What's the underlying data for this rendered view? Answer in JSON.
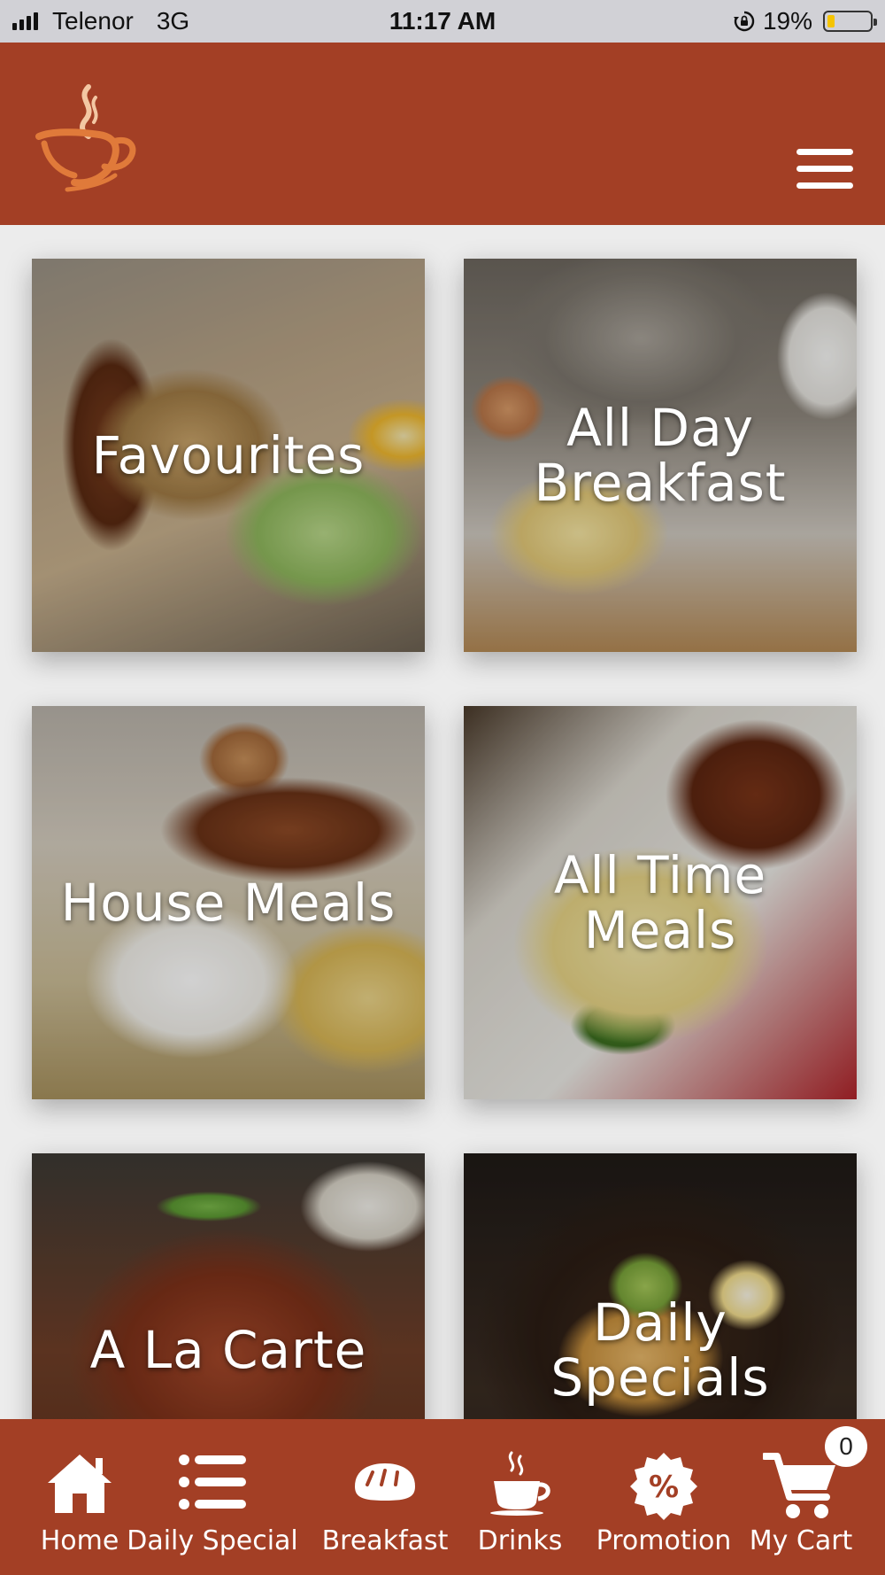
{
  "status_bar": {
    "carrier": "Telenor",
    "network": "3G",
    "time": "11:17 AM",
    "battery": "19%",
    "battery_level": 0.19
  },
  "header": {
    "logo_icon": "coffee-cup-logo-icon",
    "menu_icon": "hamburger-menu-icon"
  },
  "categories": [
    {
      "label": "Favourites"
    },
    {
      "label": "All Day Breakfast"
    },
    {
      "label": "House Meals"
    },
    {
      "label": "All Time Meals"
    },
    {
      "label": "A La Carte"
    },
    {
      "label": "Daily Specials"
    }
  ],
  "bottom_nav": {
    "items": [
      {
        "label": "Home",
        "icon": "home-icon"
      },
      {
        "label": "Daily Special",
        "icon": "list-icon"
      },
      {
        "label": "Breakfast",
        "icon": "bread-icon"
      },
      {
        "label": "Drinks",
        "icon": "coffee-cup-icon"
      },
      {
        "label": "Promotion",
        "icon": "percent-badge-icon"
      },
      {
        "label": "My Cart",
        "icon": "cart-icon"
      }
    ],
    "cart_count": "0"
  },
  "colors": {
    "brand": "#a33f25",
    "logo": "#e07a3a"
  }
}
